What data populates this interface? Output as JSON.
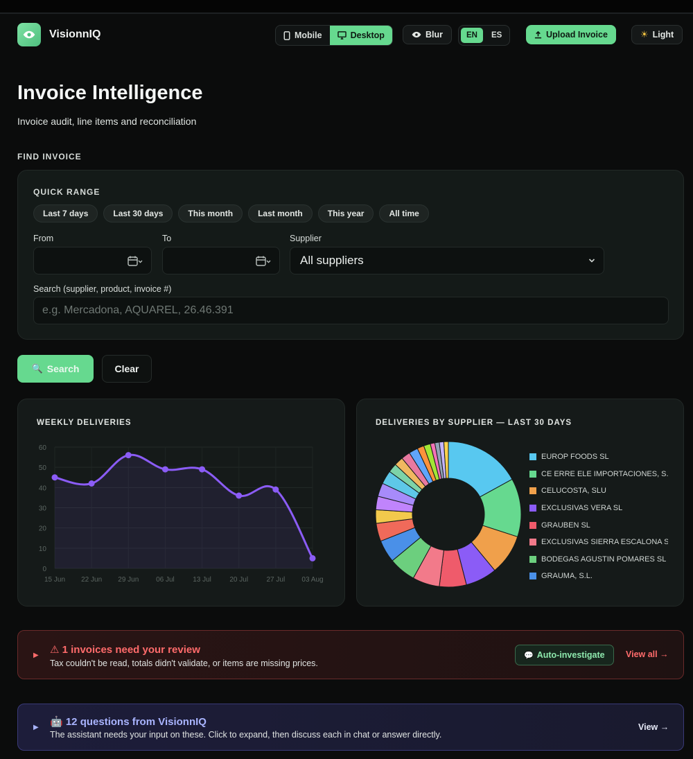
{
  "app": {
    "brand": "VisionnIQ"
  },
  "nav": {
    "mobile_label": "Mobile",
    "desktop_label": "Desktop",
    "blur_label": "Blur",
    "lang_en": "EN",
    "lang_es": "ES",
    "upload_label": "Upload Invoice",
    "light_label": "Light"
  },
  "header": {
    "title": "Invoice Intelligence",
    "subtitle": "Invoice audit, line items and reconciliation"
  },
  "find": {
    "section_label": "FIND INVOICE",
    "quick_range_label": "QUICK RANGE",
    "quick_ranges": [
      "Last 7 days",
      "Last 30 days",
      "This month",
      "Last month",
      "This year",
      "All time"
    ],
    "from_label": "From",
    "to_label": "To",
    "supplier_label": "Supplier",
    "supplier_value": "All suppliers",
    "search_label": "Search (supplier, product, invoice #)",
    "search_placeholder": "e.g. Mercadona, AQUAREL, 26.46.391",
    "search_button": "Search",
    "clear_button": "Clear"
  },
  "chart_data": [
    {
      "type": "line",
      "title": "WEEKLY DELIVERIES",
      "x": [
        "15 Jun",
        "22 Jun",
        "29 Jun",
        "06 Jul",
        "13 Jul",
        "20 Jul",
        "27 Jul",
        "03 Aug"
      ],
      "series": [
        {
          "values": [
            45,
            42,
            56,
            49,
            49,
            36,
            39,
            5
          ],
          "color": "#8b5cf6"
        }
      ],
      "y_ticks": [
        0,
        10,
        20,
        30,
        40,
        50,
        60
      ],
      "ylim": [
        0,
        60
      ],
      "grid": true
    },
    {
      "type": "pie",
      "title": "DELIVERIES BY SUPPLIER — LAST 30 DAYS",
      "legend_position": "right",
      "labels": [
        "EUROP FOODS SL",
        "CE ERRE ELE IMPORTACIONES, S.L",
        "CELUCOSTA, SLU",
        "EXCLUSIVAS VERA SL",
        "GRAUBEN SL",
        "EXCLUSIVAS SIERRA ESCALONA SL",
        "BODEGAS AGUSTIN POMARES SL",
        "GRAUMA, S.L."
      ],
      "values": [
        17,
        13,
        9,
        7,
        6,
        6,
        6,
        5,
        4,
        3,
        3,
        3,
        3,
        2,
        2,
        2,
        2,
        1.5,
        1.5,
        1,
        1,
        1,
        1
      ],
      "colors": [
        "#58c8f0",
        "#66d98f",
        "#f0a04b",
        "#8b5cf6",
        "#ef5b6b",
        "#f27a8a",
        "#6ccf7e",
        "#4a90e8",
        "#f06a5a",
        "#f2c94c",
        "#c084fc",
        "#a78bfa",
        "#5ec8e8",
        "#7dd3a8",
        "#f0b860",
        "#e879a0",
        "#60a5fa",
        "#fb923c",
        "#a3e635",
        "#f472b6",
        "#94a3b8",
        "#c4b5fd",
        "#fcd34d"
      ]
    }
  ],
  "review": {
    "title": "⚠ 1 invoices need your review",
    "desc": "Tax couldn't be read, totals didn't validate, or items are missing prices.",
    "investigate_label": "Auto-investigate",
    "view_label": "View all →"
  },
  "questions": {
    "title": "🤖 12 questions from VisionnIQ",
    "desc": "The assistant needs your input on these. Click to expand, then discuss each in chat or answer directly.",
    "view_label": "View →"
  },
  "colors": {
    "accent": "#66d98f",
    "background": "#0b0c0c",
    "card": "#141a18",
    "review_text": "#ff6b6b",
    "questions_text": "#a9b4ff"
  }
}
